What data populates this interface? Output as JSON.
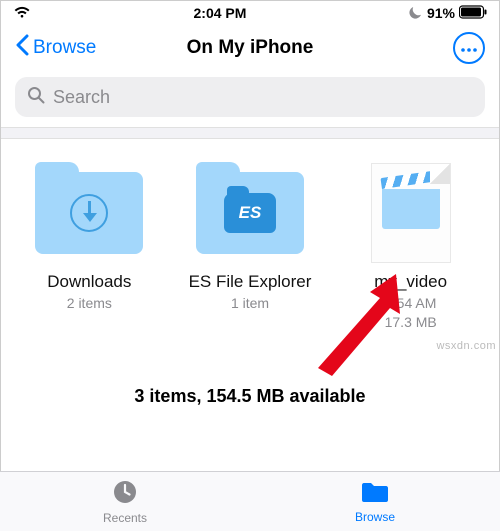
{
  "status": {
    "time": "2:04 PM",
    "battery": "91%"
  },
  "nav": {
    "back": "Browse",
    "title": "On My iPhone"
  },
  "search": {
    "placeholder": "Search"
  },
  "items": [
    {
      "name": "Downloads",
      "meta1": "2 items",
      "meta2": ""
    },
    {
      "name": "ES File Explorer",
      "meta1": "1 item",
      "meta2": ""
    },
    {
      "name": "my_video",
      "meta1": "3:54 AM",
      "meta2": "17.3 MB"
    }
  ],
  "summary": "3 items, 154.5 MB available",
  "tabs": {
    "recents": "Recents",
    "browse": "Browse"
  },
  "watermark": "wsxdn.com"
}
